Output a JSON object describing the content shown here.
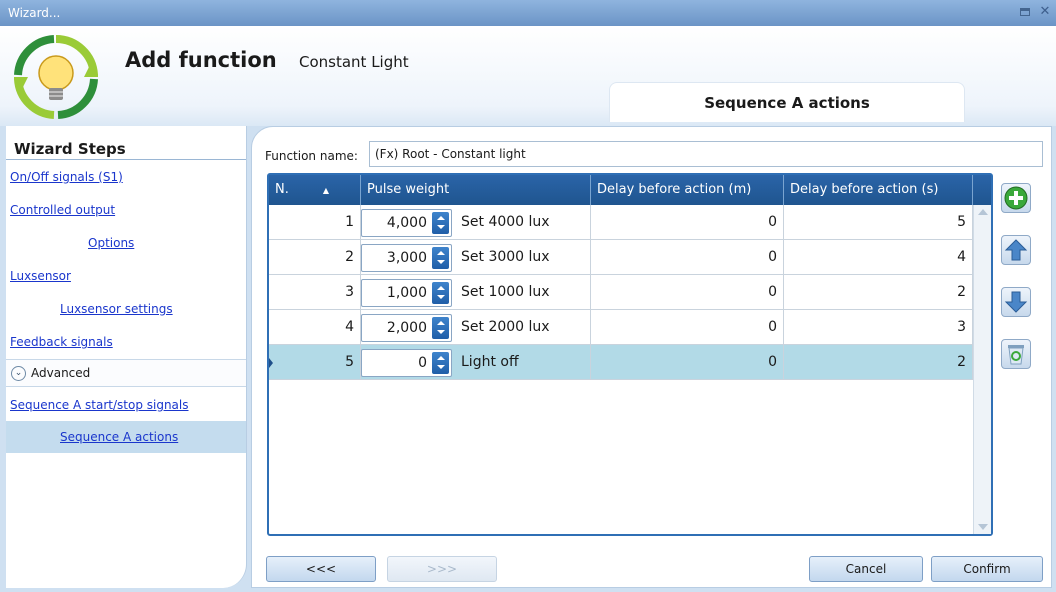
{
  "window": {
    "title": "Wizard..."
  },
  "header": {
    "title": "Add function",
    "subtitle": "Constant Light",
    "section_tab": "Sequence A actions"
  },
  "sidebar": {
    "title": "Wizard Steps",
    "items": [
      {
        "label": "On/Off signals (S1)"
      },
      {
        "label": "Controlled output"
      },
      {
        "label": "Options"
      },
      {
        "label": "Luxsensor"
      },
      {
        "label": "Luxsensor settings"
      },
      {
        "label": "Feedback signals"
      },
      {
        "label": "Advanced"
      },
      {
        "label": "Sequence A start/stop signals"
      },
      {
        "label": "Sequence A actions"
      }
    ]
  },
  "main": {
    "function_name_label": "Function name:",
    "function_name_value": "(Fx) Root - Constant light",
    "table": {
      "columns": [
        "N.",
        "Pulse weight",
        "Delay before action (m)",
        "Delay before action (s)"
      ],
      "rows": [
        {
          "n": "1",
          "pulse": "4,000",
          "label": "Set 4000 lux",
          "delay_m": "0",
          "delay_s": "5"
        },
        {
          "n": "2",
          "pulse": "3,000",
          "label": "Set 3000 lux",
          "delay_m": "0",
          "delay_s": "4"
        },
        {
          "n": "3",
          "pulse": "1,000",
          "label": "Set 1000 lux",
          "delay_m": "0",
          "delay_s": "2"
        },
        {
          "n": "4",
          "pulse": "2,000",
          "label": "Set 2000 lux",
          "delay_m": "0",
          "delay_s": "3"
        },
        {
          "n": "5",
          "pulse": "0",
          "label": "Light off",
          "delay_m": "0",
          "delay_s": "2"
        }
      ]
    }
  },
  "footer": {
    "back": "<<<",
    "next": ">>>",
    "cancel": "Cancel",
    "confirm": "Confirm"
  },
  "colors": {
    "header_blue": "#1f558f",
    "selected_row": "#b2dae7",
    "link": "#1a36cc"
  }
}
